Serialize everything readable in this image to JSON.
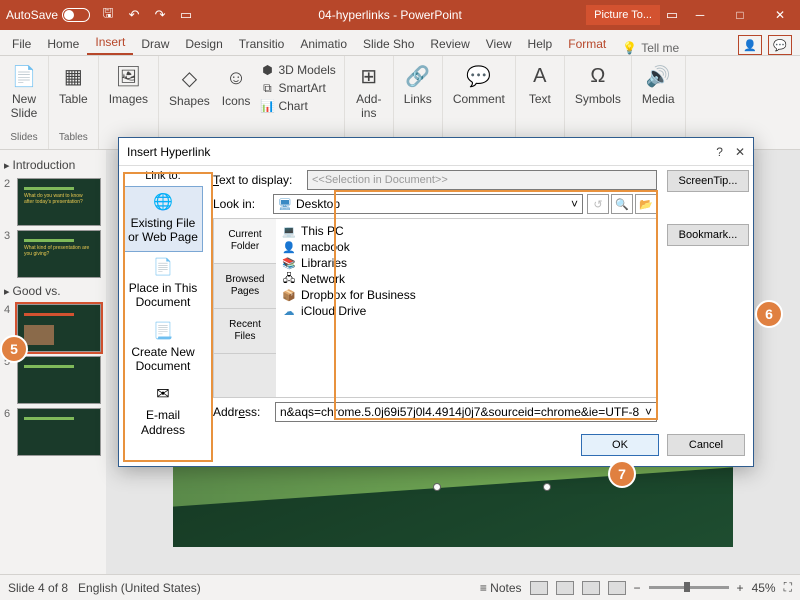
{
  "titlebar": {
    "autosave": "AutoSave",
    "title": "04-hyperlinks - PowerPoint",
    "contextTab": "Picture To..."
  },
  "tabs": [
    "File",
    "Home",
    "Insert",
    "Draw",
    "Design",
    "Transitio",
    "Animatio",
    "Slide Sho",
    "Review",
    "View",
    "Help",
    "Format"
  ],
  "tellMe": "Tell me",
  "ribbon": {
    "newSlide": "New\nSlide",
    "slides": "Slides",
    "table": "Table",
    "tables": "Tables",
    "images": "Images",
    "shapes": "Shapes",
    "icons": "Icons",
    "models": "3D Models",
    "smartart": "SmartArt",
    "chart": "Chart",
    "addins": "Add-\nins",
    "links": "Links",
    "comment": "Comment",
    "text": "Text",
    "symbols": "Symbols",
    "media": "Media"
  },
  "sections": {
    "intro": "Introduction",
    "good": "Good vs."
  },
  "thumbs": [
    "2",
    "3",
    "4",
    "5",
    "6"
  ],
  "dialog": {
    "title": "Insert Hyperlink",
    "linkTo": "Link to:",
    "textToDisplay": "Text to display:",
    "selectionPlaceholder": "<<Selection in Document>>",
    "screentip": "ScreenTip...",
    "lookin": "Look in:",
    "desktop": "Desktop",
    "bookmark": "Bookmark...",
    "addressLabel": "Address:",
    "addressValue": "n&aqs=chrome.5.0j69i57j0l4.4914j0j7&sourceid=chrome&ie=UTF-8",
    "ok": "OK",
    "cancel": "Cancel",
    "linkButtons": {
      "existing": "Existing File\nor Web Page",
      "place": "Place in This\nDocument",
      "create": "Create New\nDocument",
      "email": "E-mail\nAddress"
    },
    "browseTabs": {
      "current": "Current\nFolder",
      "browsed": "Browsed\nPages",
      "recent": "Recent\nFiles"
    },
    "items": [
      "This PC",
      "macbook",
      "Libraries",
      "Network",
      "Dropbox for Business",
      "iCloud Drive"
    ]
  },
  "status": {
    "slide": "Slide 4 of 8",
    "lang": "English (United States)",
    "notes": "Notes",
    "zoom": "45%"
  },
  "callouts": {
    "five": "5",
    "six": "6",
    "seven": "7"
  }
}
